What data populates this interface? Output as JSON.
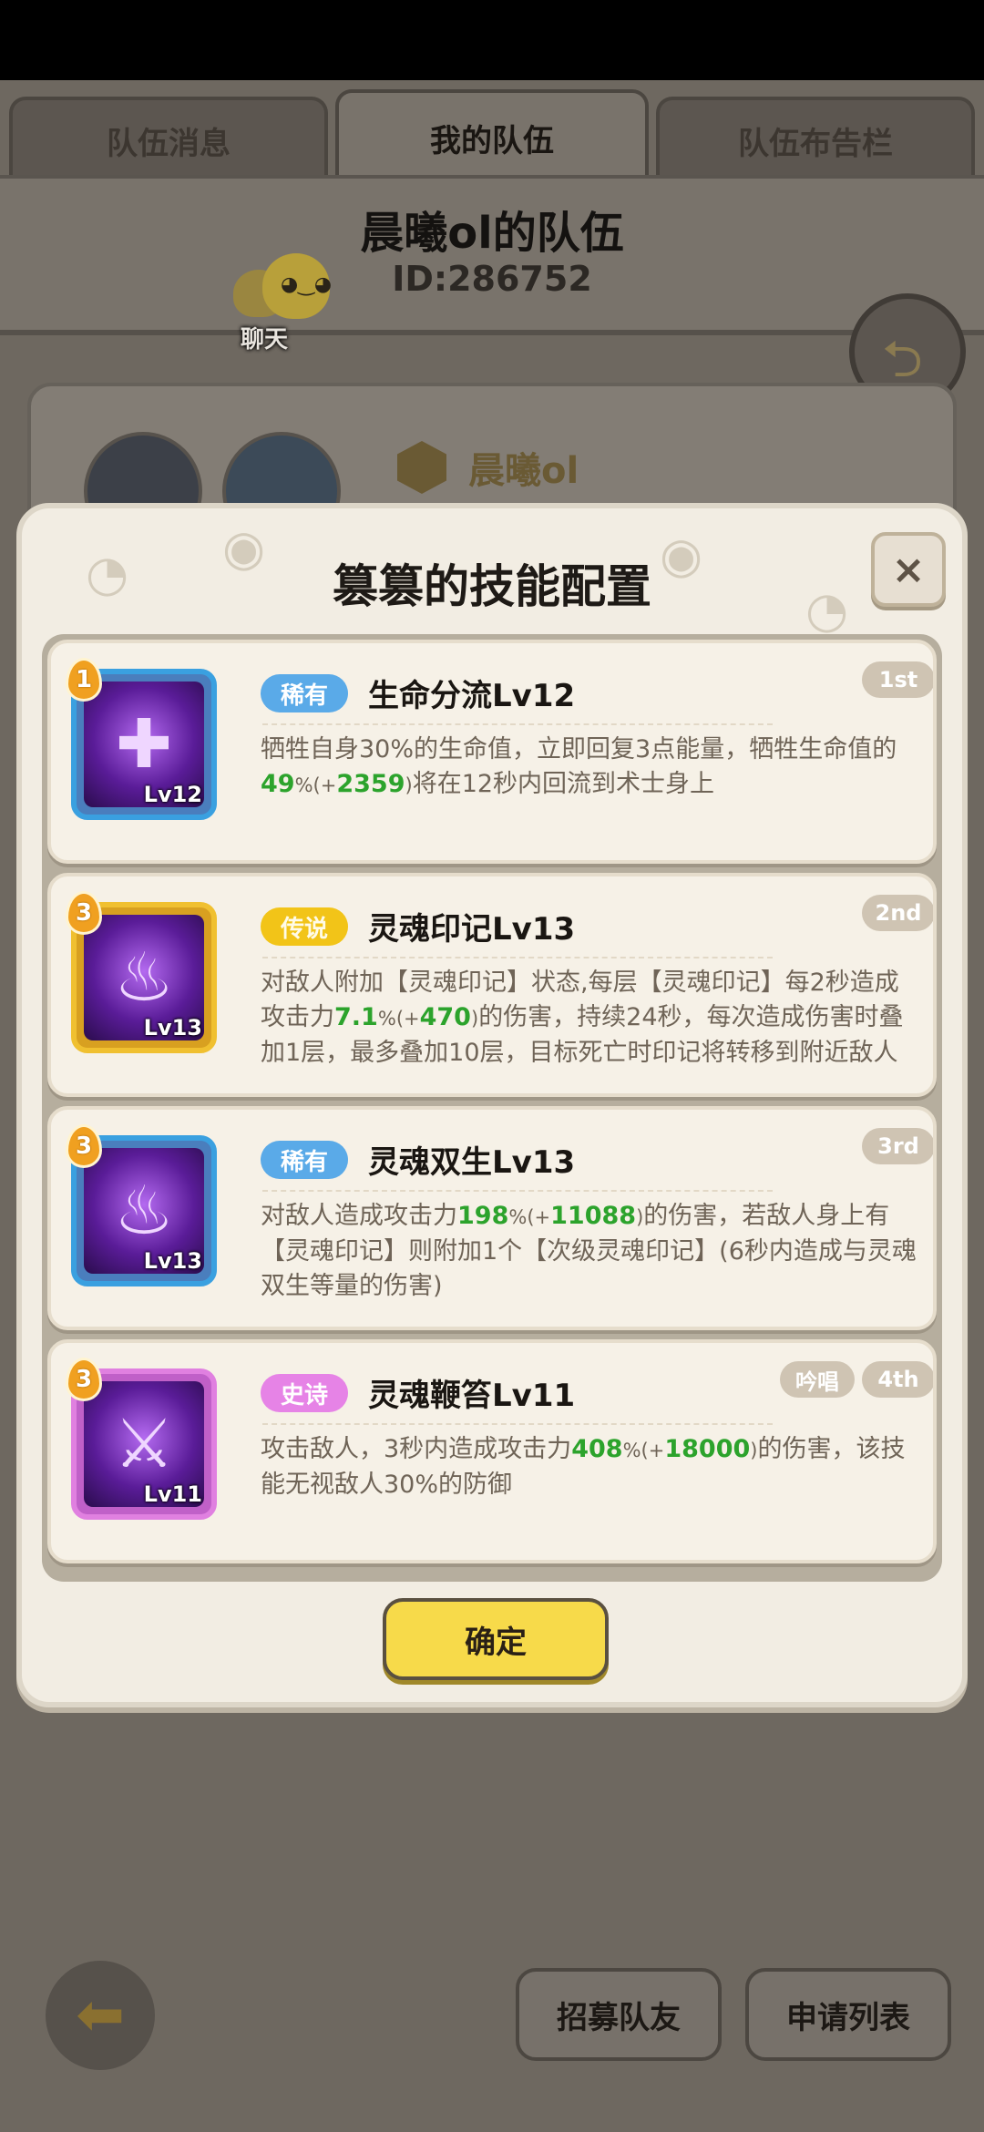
{
  "tabs": [
    "队伍消息",
    "我的队伍",
    "队伍布告栏"
  ],
  "team": {
    "name": "晨曦ol的队伍",
    "id_label": "ID:286752",
    "chat_label": "聊天"
  },
  "member": {
    "name": "晨曦ol"
  },
  "bottom_buttons": {
    "recruit": "招募队友",
    "apply_list": "申请列表"
  },
  "modal": {
    "title": "篡篡的技能配置",
    "close": "×",
    "confirm": "确定",
    "skills": [
      {
        "slot": "1",
        "rarity": "稀有",
        "rarity_color": "#5aaae8",
        "name": "生命分流Lv12",
        "icon_level": "Lv12",
        "order": "1st",
        "icon_name": "heal-cross-icon",
        "desc": [
          {
            "t": "牺牲自身30%的生命值，立即回复3点能量，牺牲生命值的"
          },
          {
            "t": "49",
            "hl": true
          },
          {
            "t": "%",
            "sm": true
          },
          {
            "t": "(+",
            "sm": true
          },
          {
            "t": "2359",
            "hl": true
          },
          {
            "t": ")",
            "sm": true
          },
          {
            "t": "将在12秒内回流到术士身上"
          }
        ]
      },
      {
        "slot": "3",
        "rarity": "传说",
        "rarity_color": "#f2c418",
        "name": "灵魂印记Lv13",
        "icon_level": "Lv13",
        "order": "2nd",
        "icon_name": "soul-flame-icon",
        "desc": [
          {
            "t": "对敌人附加【灵魂印记】状态,每层【灵魂印记】每2秒造成攻击力"
          },
          {
            "t": "7.1",
            "hl": true
          },
          {
            "t": "%",
            "sm": true
          },
          {
            "t": "(+",
            "sm": true
          },
          {
            "t": "470",
            "hl": true
          },
          {
            "t": ")",
            "sm": true
          },
          {
            "t": "的伤害，持续24秒，每次造成伤害时叠加1层，最多叠加10层，目标死亡时印记将转移到附近敌人"
          }
        ]
      },
      {
        "slot": "3",
        "rarity": "稀有",
        "rarity_color": "#5aaae8",
        "name": "灵魂双生Lv13",
        "icon_level": "Lv13",
        "order": "3rd",
        "icon_name": "twin-flame-icon",
        "desc": [
          {
            "t": "对敌人造成攻击力"
          },
          {
            "t": "198",
            "hl": true
          },
          {
            "t": "%",
            "sm": true
          },
          {
            "t": "(+",
            "sm": true
          },
          {
            "t": "11088",
            "hl": true
          },
          {
            "t": ")",
            "sm": true
          },
          {
            "t": "的伤害，若敌人身上有【灵魂印记】则附加1个【次级灵魂印记】(6秒内造成与灵魂双生等量的伤害)"
          }
        ]
      },
      {
        "slot": "3",
        "rarity": "史诗",
        "rarity_color": "#e683e6",
        "name": "灵魂鞭笞Lv11",
        "icon_level": "Lv11",
        "order": "4th",
        "chant": "吟唱",
        "icon_name": "soul-whip-icon",
        "desc": [
          {
            "t": "攻击敌人，3秒内造成攻击力"
          },
          {
            "t": "408",
            "hl": true
          },
          {
            "t": "%",
            "sm": true
          },
          {
            "t": "(+",
            "sm": true
          },
          {
            "t": "18000",
            "hl": true
          },
          {
            "t": ")",
            "sm": true
          },
          {
            "t": "的伤害，该技能无视敌人30%的防御"
          }
        ]
      }
    ]
  }
}
